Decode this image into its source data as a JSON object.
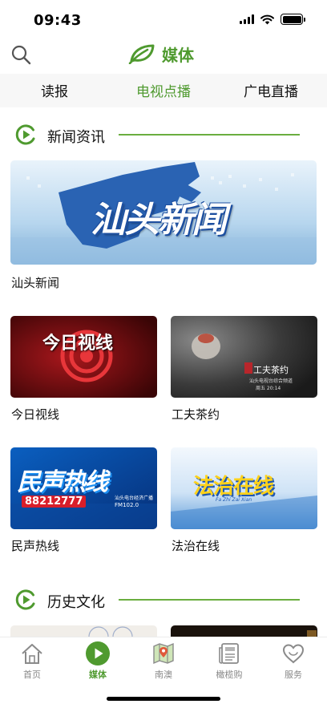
{
  "status_bar": {
    "time": "09:43",
    "icons": [
      "signal-icon",
      "wifi-icon",
      "battery-icon"
    ]
  },
  "header": {
    "title": "媒体",
    "search_icon": "search-icon",
    "logo_icon": "leaf-logo-icon"
  },
  "tabs": [
    {
      "label": "读报",
      "active": false
    },
    {
      "label": "电视点播",
      "active": true
    },
    {
      "label": "广电直播",
      "active": false
    }
  ],
  "sections": [
    {
      "title": "新闻资讯",
      "icon": "play-circle-icon",
      "items": [
        {
          "caption": "汕头新闻",
          "thumb_text": "汕头新闻"
        },
        {
          "caption": "今日视线",
          "thumb_text": "今日视线"
        },
        {
          "caption": "工夫茶约",
          "thumb_text": "工夫茶约",
          "thumb_subtext": "汕头电视台综合频道",
          "thumb_time": "周五 20:14"
        },
        {
          "caption": "民声热线",
          "thumb_text": "民声热线",
          "thumb_phone": "88212777",
          "thumb_sub": "汕头电台经济广播",
          "thumb_fm": "FM102.0"
        },
        {
          "caption": "法治在线",
          "thumb_text": "法治在线",
          "thumb_pinyin": "Fa Zhi Zai Xian"
        }
      ]
    },
    {
      "title": "历史文化",
      "icon": "play-circle-icon",
      "items": []
    }
  ],
  "tabbar": [
    {
      "label": "首页",
      "icon": "home-icon",
      "active": false
    },
    {
      "label": "媒体",
      "icon": "play-icon",
      "active": true
    },
    {
      "label": "南澳",
      "icon": "map-icon",
      "active": false
    },
    {
      "label": "橄榄购",
      "icon": "newspaper-icon",
      "active": false
    },
    {
      "label": "服务",
      "icon": "heart-icon",
      "active": false
    }
  ],
  "colors": {
    "accent": "#4f9a2f",
    "line": "#6aae3f",
    "tab_bg": "#f7f7f7"
  }
}
